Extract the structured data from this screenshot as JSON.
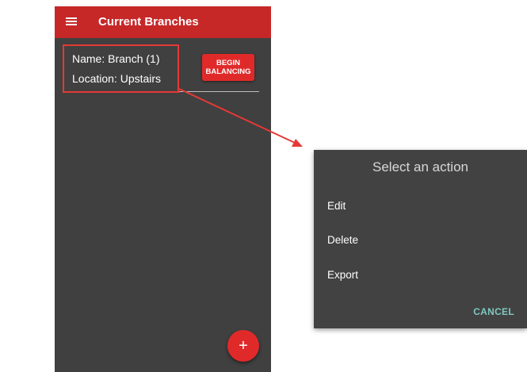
{
  "appbar": {
    "title": "Current Branches",
    "menu_icon": "hamburger-menu-icon",
    "color": "#c62828"
  },
  "branch_list": [
    {
      "name_text": "Name: Branch (1)",
      "location_text": "Location: Upstairs",
      "action_label_line1": "BEGIN",
      "action_label_line2": "BALANCING"
    }
  ],
  "fab": {
    "icon": "plus-icon",
    "glyph": "+"
  },
  "dialog": {
    "title": "Select an action",
    "items": [
      "Edit",
      "Delete",
      "Export"
    ],
    "cancel_label": "CANCEL"
  },
  "colors": {
    "accent_red": "#e02a2a",
    "screen_background": "#404040",
    "dialog_background": "#424242",
    "cancel_teal": "#7ec8c0",
    "annotation_red": "#e53935"
  }
}
